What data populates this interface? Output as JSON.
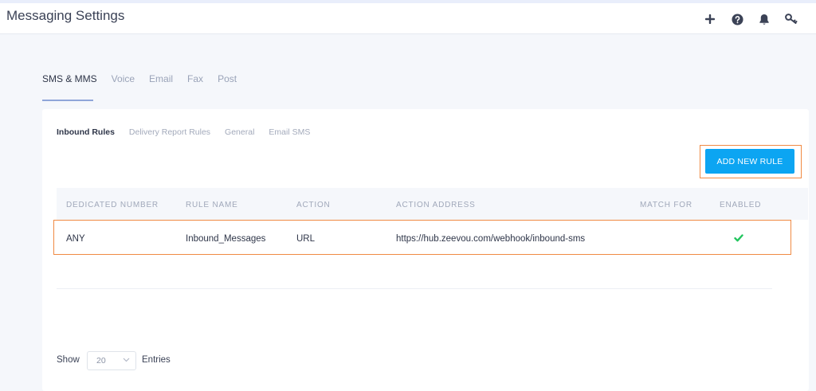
{
  "header": {
    "title": "Messaging Settings",
    "icons": [
      "plus-icon",
      "help-icon",
      "bell-icon",
      "key-icon"
    ]
  },
  "tabs": [
    {
      "label": "SMS & MMS",
      "active": true
    },
    {
      "label": "Voice",
      "active": false
    },
    {
      "label": "Email",
      "active": false
    },
    {
      "label": "Fax",
      "active": false
    },
    {
      "label": "Post",
      "active": false
    }
  ],
  "subtabs": [
    {
      "label": "Inbound Rules",
      "active": true
    },
    {
      "label": "Delivery Report Rules",
      "active": false
    },
    {
      "label": "General",
      "active": false
    },
    {
      "label": "Email SMS",
      "active": false
    }
  ],
  "add_rule_label": "ADD NEW RULE",
  "table": {
    "columns": [
      "DEDICATED NUMBER",
      "RULE NAME",
      "ACTION",
      "ACTION ADDRESS",
      "MATCH FOR",
      "ENABLED"
    ],
    "rows": [
      {
        "dedicated_number": "ANY",
        "rule_name": "Inbound_Messages",
        "action": "URL",
        "action_address": "https://hub.zeevou.com/webhook/inbound-sms",
        "match_for": "",
        "enabled": true
      }
    ]
  },
  "pagination": {
    "show_label": "Show",
    "entries_value": "20",
    "entries_label": "Entries"
  },
  "colors": {
    "accent": "#0ca5f2",
    "highlight": "#f08a43",
    "check": "#22c55e"
  }
}
